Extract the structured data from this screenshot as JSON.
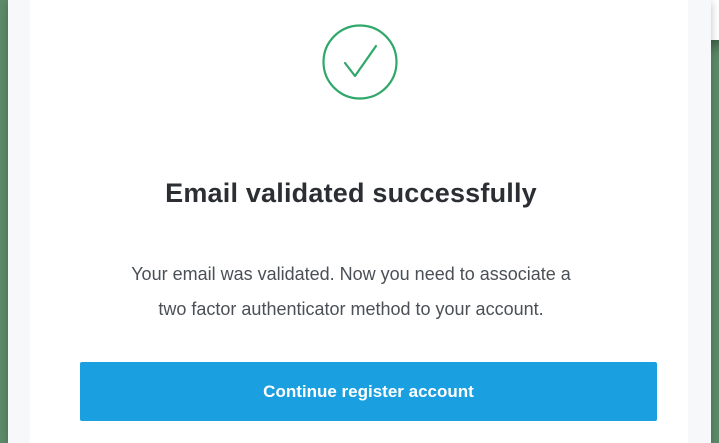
{
  "colors": {
    "background": "#5d8b6a",
    "success_accent": "#2fa86a",
    "primary_button": "#1aa0e0",
    "title_text": "#2b2f33",
    "body_text": "#4a5056"
  },
  "status_icon": "check-circle-icon",
  "content": {
    "title": "Email validated successfully",
    "message_line1": "Your email was validated. Now you need to associate a",
    "message_line2": "two factor authenticator method to your account.",
    "continue_button_label": "Continue register account"
  }
}
